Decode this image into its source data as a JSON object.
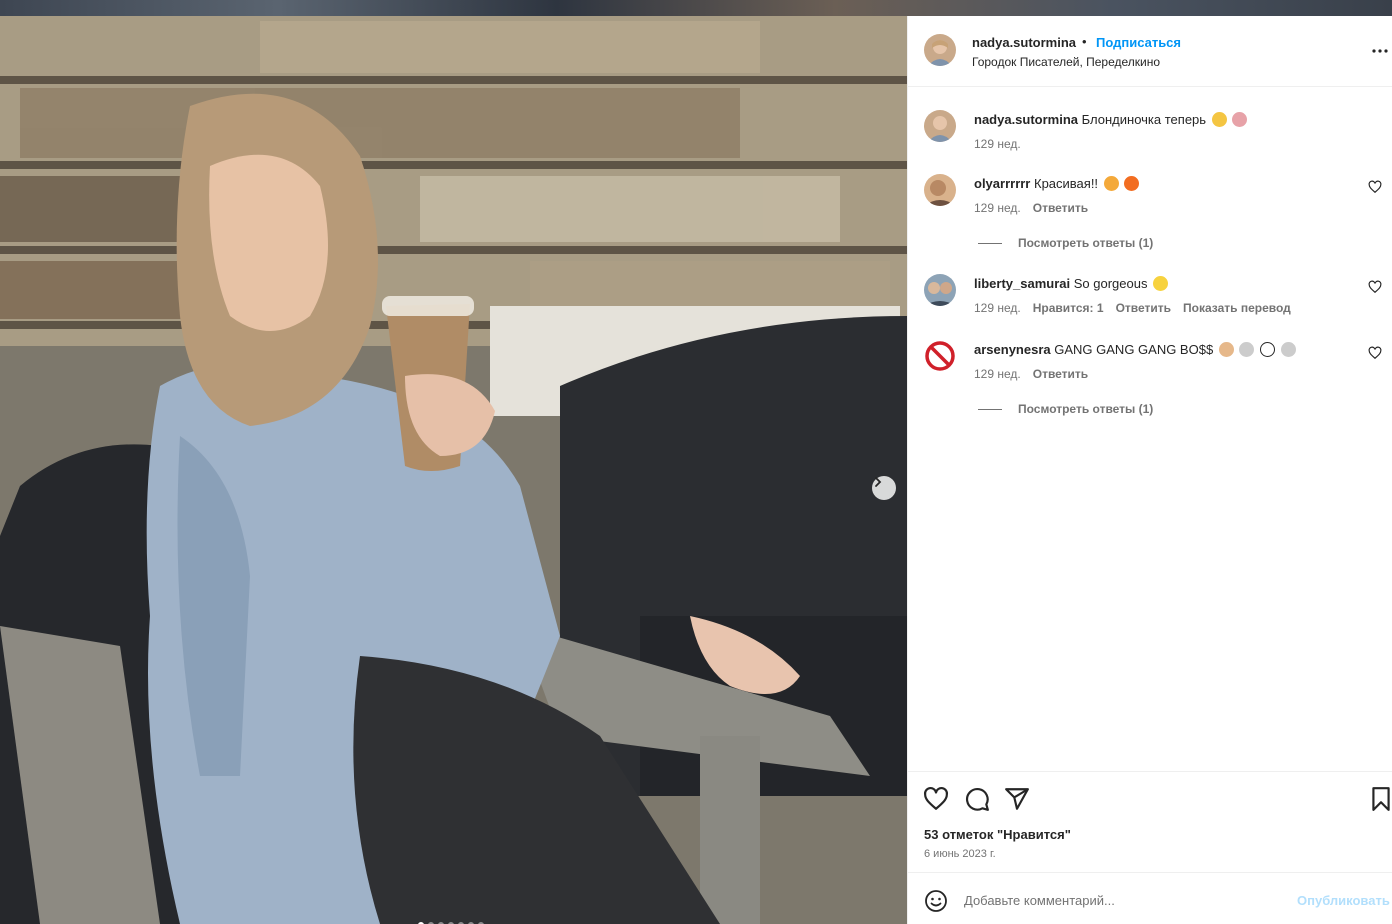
{
  "post": {
    "author": "nadya.sutormina",
    "separator": "•",
    "follow_label": "Подписаться",
    "location": "Городок Писателей, Переделкино",
    "more_icon": "more-horizontal-icon"
  },
  "comments": [
    {
      "user": "nadya.sutormina",
      "text": "Блондиночка теперь",
      "emojis": [
        "#f4c542",
        "#e7a2a8"
      ],
      "time": "129 нед.",
      "actions": []
    },
    {
      "user": "olyarrrrrr",
      "text": "Красивая!!",
      "emojis": [
        "#f4a93a",
        "#f26d21"
      ],
      "time": "129 нед.",
      "actions": [
        "Ответить"
      ],
      "replies": "Посмотреть ответы (1)"
    },
    {
      "user": "liberty_samurai",
      "text": "So gorgeous",
      "emojis": [
        "#f7d23e"
      ],
      "time": "129 нед.",
      "actions": [
        "Нравится: 1",
        "Ответить",
        "Показать перевод"
      ]
    },
    {
      "user": "arsenynesra",
      "text": "GANG GANG GANG BO$$",
      "emojis": [
        "#e6b88a",
        "#cccccc",
        "#ffffff",
        "#cccccc"
      ],
      "time": "129 нед.",
      "actions": [
        "Ответить"
      ],
      "replies": "Посмотреть ответы (1)"
    }
  ],
  "footer": {
    "likes": "53 отметок \"Нравится\"",
    "date": "6 июнь 2023 г.",
    "comment_placeholder": "Добавьте комментарий...",
    "publish_label": "Опубликовать"
  },
  "carousel": {
    "total": 7,
    "current": 1
  },
  "colors": {
    "accent": "#0095f6",
    "publish_disabled": "#b2dffc",
    "muted": "#737373"
  }
}
